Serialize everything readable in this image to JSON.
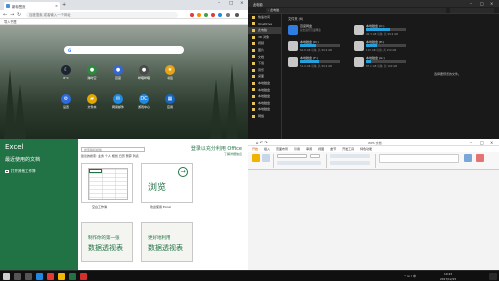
{
  "browser": {
    "tab_title": "新标签页",
    "tab_close": "×",
    "new_tab": "+",
    "window_controls": [
      "–",
      "□",
      "×"
    ],
    "nav_icons": [
      "←",
      "→",
      "↻"
    ],
    "address_placeholder": "百度搜索,或者输入一个网址",
    "bookmark": "导入书签",
    "search_logo": "G",
    "tiles_row1": [
      {
        "label": "6°C",
        "icon": "moon-icon",
        "glyph": "☾",
        "color": "#1b2430"
      },
      {
        "label": "跨时空",
        "icon": "game-icon",
        "glyph": "●",
        "color": "#2b8a3e"
      },
      {
        "label": "百度",
        "icon": "baidu-icon",
        "glyph": "●",
        "color": "#3367d6"
      },
      {
        "label": "哔哩哔哩",
        "icon": "bilibili-icon",
        "glyph": "●",
        "color": "#4a4a4a"
      },
      {
        "label": "书签",
        "icon": "star-icon",
        "glyph": "★",
        "color": "#e8a317"
      }
    ],
    "tiles_row2": [
      {
        "label": "设置",
        "icon": "gear-icon",
        "glyph": "⚙",
        "color": "#2d6cdf"
      },
      {
        "label": "文件夹",
        "icon": "folder-icon",
        "glyph": "▰",
        "color": "#e0a800"
      },
      {
        "label": "网易邮件",
        "icon": "mail-icon",
        "glyph": "✉",
        "color": "#1f8ae0"
      },
      {
        "label": "游戏中心",
        "icon": "dc-icon",
        "glyph": "DC",
        "color": "#1e88e5"
      },
      {
        "label": "应用",
        "icon": "apps-icon",
        "glyph": "▦",
        "color": "#1565c0"
      }
    ]
  },
  "explorer": {
    "title": "此电脑",
    "window_controls": [
      "–",
      "□",
      "×"
    ],
    "address": "› 此电脑",
    "nav_items": [
      "快速访问",
      "OneDrive",
      "此电脑",
      "3D 对象",
      "视频",
      "图片",
      "文档",
      "下载",
      "音乐",
      "桌面",
      "本地磁盘",
      "本地磁盘",
      "本地磁盘",
      "本地磁盘",
      "本地磁盘",
      "网络"
    ],
    "section_label": "文件夹 (6)",
    "drives": [
      {
        "name": "百度网盘",
        "sub": "双击运行百度网盘",
        "fill": 0.0,
        "color": "#2f7de1"
      },
      {
        "name": "本地磁盘 (C:)",
        "sub": "40.3 GB 可用, 共 99.9 GB",
        "fill": 0.6,
        "color": "#c7c7c7"
      },
      {
        "name": "本地磁盘 (D:)",
        "sub": "60.8 GB 可用, 共 99.9 GB",
        "fill": 0.39,
        "color": "#c7c7c7"
      },
      {
        "name": "本地磁盘 (E:)",
        "sub": "110 GB 可用, 共 150 GB",
        "fill": 0.27,
        "color": "#c7c7c7"
      },
      {
        "name": "本地磁盘 (F:)",
        "sub": "51.9 GB 可用, 共 99.9 GB",
        "fill": 0.48,
        "color": "#c7c7c7"
      },
      {
        "name": "本地磁盘 (G:)",
        "sub": "87.1 GB 可用, 共 100 GB",
        "fill": 0.13,
        "color": "#c7c7c7"
      }
    ],
    "empty_hint": "选择要预览的文件。"
  },
  "excel": {
    "app_name": "Excel",
    "recent_title": "最近使用的文档",
    "open_other": "打开其他工作簿",
    "search_placeholder": "搜索联机模板",
    "suggested": "建议的搜索: 业务 个人 规划 日历 预算 列表",
    "signin": "登录以充分利用 Office",
    "learn_more": "了解详细信息",
    "templates": [
      {
        "caption": "空白工作簿",
        "kind": "blank"
      },
      {
        "caption": "欢迎使用 Excel",
        "kind": "tour",
        "big": "浏览",
        "arrow": "→"
      },
      {
        "caption": "",
        "kind": "pivot",
        "l1": "制作你的第一张",
        "l2": "数据透视表"
      },
      {
        "caption": "",
        "kind": "pivot",
        "l1": "更好地利用",
        "l2": "数据透视表"
      }
    ]
  },
  "office": {
    "title": "WPS 文档",
    "quick": "⌂ ↶ ↷",
    "window_controls": [
      "–",
      "□",
      "×"
    ],
    "tabs": [
      "开始",
      "插入",
      "页面布局",
      "引用",
      "审阅",
      "视图",
      "章节",
      "开发工具",
      "特色功能"
    ],
    "active_tab": "开始"
  },
  "taskbar": {
    "apps": [
      {
        "icon": "start-icon",
        "color": "#cfcfcf"
      },
      {
        "icon": "search-icon",
        "color": "#555555"
      },
      {
        "icon": "taskview-icon",
        "color": "#555555"
      },
      {
        "icon": "edge-icon",
        "color": "#1e88e5"
      },
      {
        "icon": "chrome-icon",
        "color": "#e53935"
      },
      {
        "icon": "explorer-icon",
        "color": "#f2b705"
      },
      {
        "icon": "excel-icon",
        "color": "#217346"
      },
      {
        "icon": "wps-icon",
        "color": "#d32f2f"
      }
    ],
    "tray_text": "^ ⊡ ♪ 中",
    "time": "10:23",
    "date": "2017/12/15"
  },
  "colors": {
    "excel_green": "#217346",
    "explorer_bg": "#191919",
    "accent_blue": "#26a0da"
  }
}
